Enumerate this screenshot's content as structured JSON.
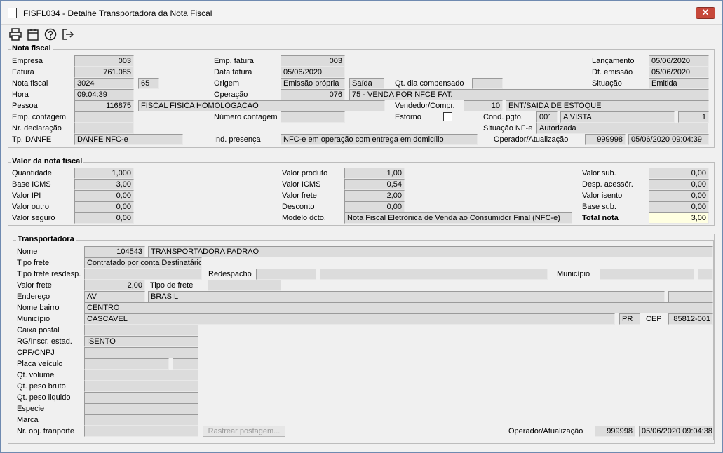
{
  "window": {
    "title": "FISFL034 - Detalhe Transportadora da Nota Fiscal"
  },
  "nota_fiscal": {
    "group_title": "Nota fiscal",
    "empresa_label": "Empresa",
    "empresa": "003",
    "fatura_label": "Fatura",
    "fatura": "761.085",
    "nota_label": "Nota fiscal",
    "nota": "3024",
    "serie": "65",
    "hora_label": "Hora",
    "hora": "09:04:39",
    "pessoa_label": "Pessoa",
    "pessoa_code": "116875",
    "pessoa_name": "FISCAL FISICA HOMOLOGACAO",
    "emp_contagem_label": "Emp. contagem",
    "nr_declaracao_label": "Nr. declaração",
    "tp_danfe_label": "Tp. DANFE",
    "tp_danfe": "DANFE NFC-e",
    "emp_fatura_label": "Emp. fatura",
    "emp_fatura": "003",
    "data_fatura_label": "Data fatura",
    "data_fatura": "05/06/2020",
    "origem_label": "Origem",
    "origem": "Emissão própria",
    "origem_tipo": "Saída",
    "qt_dia_label": "Qt. dia compensado",
    "operacao_label": "Operação",
    "operacao_code": "076",
    "operacao_desc": "75 - VENDA POR NFCE FAT.",
    "vendedor_label": "Vendedor/Compr.",
    "vendedor_code": "10",
    "vendedor_name": "ENT/SAIDA DE ESTOQUE",
    "numero_contagem_label": "Número contagem",
    "estorno_label": "Estorno",
    "cond_pgto_label": "Cond. pgto.",
    "cond_code": "001",
    "cond_desc": "A VISTA",
    "cond_num": "1",
    "situacao_nfe_label": "Situação NF-e",
    "situacao_nfe": "Autorizada",
    "ind_presenca_label": "Ind. presença",
    "ind_presenca": "NFC-e em operação com entrega em domicílio",
    "operador_label": "Operador/Atualização",
    "operador": "999998",
    "atualizacao": "05/06/2020 09:04:39",
    "lancamento_label": "Lançamento",
    "lancamento": "05/06/2020",
    "dt_emissao_label": "Dt. emissão",
    "dt_emissao": "05/06/2020",
    "situacao_label": "Situação",
    "situacao": "Emitida"
  },
  "valor": {
    "group_title": "Valor da nota fiscal",
    "quantidade_label": "Quantidade",
    "quantidade": "1,000",
    "base_icms_label": "Base ICMS",
    "base_icms": "3,00",
    "valor_ipi_label": "Valor IPI",
    "valor_ipi": "0,00",
    "valor_outro_label": "Valor outro",
    "valor_outro": "0,00",
    "valor_seguro_label": "Valor seguro",
    "valor_seguro": "0,00",
    "valor_produto_label": "Valor produto",
    "valor_produto": "1,00",
    "valor_icms_label": "Valor ICMS",
    "valor_icms": "0,54",
    "valor_frete_label": "Valor frete",
    "valor_frete": "2,00",
    "desconto_label": "Desconto",
    "desconto": "0,00",
    "modelo_label": "Modelo dcto.",
    "modelo": "Nota Fiscal Eletrônica de Venda ao Consumidor Final (NFC-e)",
    "valor_sub_label": "Valor sub.",
    "valor_sub": "0,00",
    "desp_label": "Desp. acessór.",
    "desp": "0,00",
    "valor_isento_label": "Valor isento",
    "valor_isento": "0,00",
    "base_sub_label": "Base sub.",
    "base_sub": "0,00",
    "total_label": "Total nota",
    "total": "3,00"
  },
  "transp": {
    "group_title": "Transportadora",
    "nome_label": "Nome",
    "nome_code": "104543",
    "nome": "TRANSPORTADORA PADRAO",
    "tipo_frete_label": "Tipo frete",
    "tipo_frete": "Contratado por conta Destinatário",
    "tipo_frete_resdesp_label": "Tipo frete resdesp.",
    "redespacho_label": "Redespacho",
    "municipio_top_label": "Município",
    "valor_frete_label": "Valor frete",
    "valor_frete": "2,00",
    "tipo_de_frete_label": "Tipo de frete",
    "endereco_label": "Endereço",
    "endereco_tipo": "AV",
    "endereco": "BRASIL",
    "bairro_label": "Nome bairro",
    "bairro": "CENTRO",
    "municipio_label": "Município",
    "municipio": "CASCAVEL",
    "uf": "PR",
    "cep_label": "CEP",
    "cep": "85812-001",
    "caixa_postal_label": "Caixa postal",
    "rg_label": "RG/Inscr. estad.",
    "rg": "ISENTO",
    "cpf_label": "CPF/CNPJ",
    "placa_label": "Placa veículo",
    "qt_volume_label": "Qt. volume",
    "peso_bruto_label": "Qt. peso bruto",
    "peso_liquido_label": "Qt. peso liquido",
    "especie_label": "Especie",
    "marca_label": "Marca",
    "nr_obj_label": "Nr. obj. tranporte",
    "rastrear_label": "Rastrear postagem...",
    "operador_label": "Operador/Atualização",
    "operador": "999998",
    "atualizacao": "05/06/2020 09:04:38"
  }
}
